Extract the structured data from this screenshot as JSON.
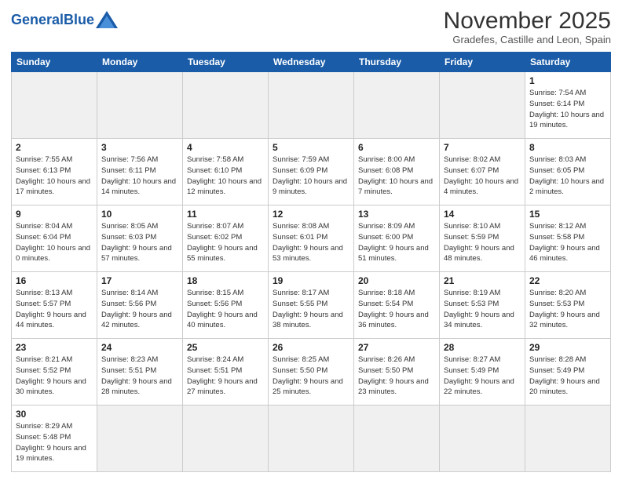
{
  "logo": {
    "text_general": "General",
    "text_blue": "Blue"
  },
  "header": {
    "month_year": "November 2025",
    "location": "Gradefes, Castille and Leon, Spain"
  },
  "weekdays": [
    "Sunday",
    "Monday",
    "Tuesday",
    "Wednesday",
    "Thursday",
    "Friday",
    "Saturday"
  ],
  "days": [
    {
      "num": "",
      "info": "",
      "empty": true
    },
    {
      "num": "",
      "info": "",
      "empty": true
    },
    {
      "num": "",
      "info": "",
      "empty": true
    },
    {
      "num": "",
      "info": "",
      "empty": true
    },
    {
      "num": "",
      "info": "",
      "empty": true
    },
    {
      "num": "",
      "info": "",
      "empty": true
    },
    {
      "num": "1",
      "info": "Sunrise: 7:54 AM\nSunset: 6:14 PM\nDaylight: 10 hours and 19 minutes."
    },
    {
      "num": "2",
      "info": "Sunrise: 7:55 AM\nSunset: 6:13 PM\nDaylight: 10 hours and 17 minutes."
    },
    {
      "num": "3",
      "info": "Sunrise: 7:56 AM\nSunset: 6:11 PM\nDaylight: 10 hours and 14 minutes."
    },
    {
      "num": "4",
      "info": "Sunrise: 7:58 AM\nSunset: 6:10 PM\nDaylight: 10 hours and 12 minutes."
    },
    {
      "num": "5",
      "info": "Sunrise: 7:59 AM\nSunset: 6:09 PM\nDaylight: 10 hours and 9 minutes."
    },
    {
      "num": "6",
      "info": "Sunrise: 8:00 AM\nSunset: 6:08 PM\nDaylight: 10 hours and 7 minutes."
    },
    {
      "num": "7",
      "info": "Sunrise: 8:02 AM\nSunset: 6:07 PM\nDaylight: 10 hours and 4 minutes."
    },
    {
      "num": "8",
      "info": "Sunrise: 8:03 AM\nSunset: 6:05 PM\nDaylight: 10 hours and 2 minutes."
    },
    {
      "num": "9",
      "info": "Sunrise: 8:04 AM\nSunset: 6:04 PM\nDaylight: 10 hours and 0 minutes."
    },
    {
      "num": "10",
      "info": "Sunrise: 8:05 AM\nSunset: 6:03 PM\nDaylight: 9 hours and 57 minutes."
    },
    {
      "num": "11",
      "info": "Sunrise: 8:07 AM\nSunset: 6:02 PM\nDaylight: 9 hours and 55 minutes."
    },
    {
      "num": "12",
      "info": "Sunrise: 8:08 AM\nSunset: 6:01 PM\nDaylight: 9 hours and 53 minutes."
    },
    {
      "num": "13",
      "info": "Sunrise: 8:09 AM\nSunset: 6:00 PM\nDaylight: 9 hours and 51 minutes."
    },
    {
      "num": "14",
      "info": "Sunrise: 8:10 AM\nSunset: 5:59 PM\nDaylight: 9 hours and 48 minutes."
    },
    {
      "num": "15",
      "info": "Sunrise: 8:12 AM\nSunset: 5:58 PM\nDaylight: 9 hours and 46 minutes."
    },
    {
      "num": "16",
      "info": "Sunrise: 8:13 AM\nSunset: 5:57 PM\nDaylight: 9 hours and 44 minutes."
    },
    {
      "num": "17",
      "info": "Sunrise: 8:14 AM\nSunset: 5:56 PM\nDaylight: 9 hours and 42 minutes."
    },
    {
      "num": "18",
      "info": "Sunrise: 8:15 AM\nSunset: 5:56 PM\nDaylight: 9 hours and 40 minutes."
    },
    {
      "num": "19",
      "info": "Sunrise: 8:17 AM\nSunset: 5:55 PM\nDaylight: 9 hours and 38 minutes."
    },
    {
      "num": "20",
      "info": "Sunrise: 8:18 AM\nSunset: 5:54 PM\nDaylight: 9 hours and 36 minutes."
    },
    {
      "num": "21",
      "info": "Sunrise: 8:19 AM\nSunset: 5:53 PM\nDaylight: 9 hours and 34 minutes."
    },
    {
      "num": "22",
      "info": "Sunrise: 8:20 AM\nSunset: 5:53 PM\nDaylight: 9 hours and 32 minutes."
    },
    {
      "num": "23",
      "info": "Sunrise: 8:21 AM\nSunset: 5:52 PM\nDaylight: 9 hours and 30 minutes."
    },
    {
      "num": "24",
      "info": "Sunrise: 8:23 AM\nSunset: 5:51 PM\nDaylight: 9 hours and 28 minutes."
    },
    {
      "num": "25",
      "info": "Sunrise: 8:24 AM\nSunset: 5:51 PM\nDaylight: 9 hours and 27 minutes."
    },
    {
      "num": "26",
      "info": "Sunrise: 8:25 AM\nSunset: 5:50 PM\nDaylight: 9 hours and 25 minutes."
    },
    {
      "num": "27",
      "info": "Sunrise: 8:26 AM\nSunset: 5:50 PM\nDaylight: 9 hours and 23 minutes."
    },
    {
      "num": "28",
      "info": "Sunrise: 8:27 AM\nSunset: 5:49 PM\nDaylight: 9 hours and 22 minutes."
    },
    {
      "num": "29",
      "info": "Sunrise: 8:28 AM\nSunset: 5:49 PM\nDaylight: 9 hours and 20 minutes."
    },
    {
      "num": "30",
      "info": "Sunrise: 8:29 AM\nSunset: 5:48 PM\nDaylight: 9 hours and 19 minutes."
    }
  ]
}
